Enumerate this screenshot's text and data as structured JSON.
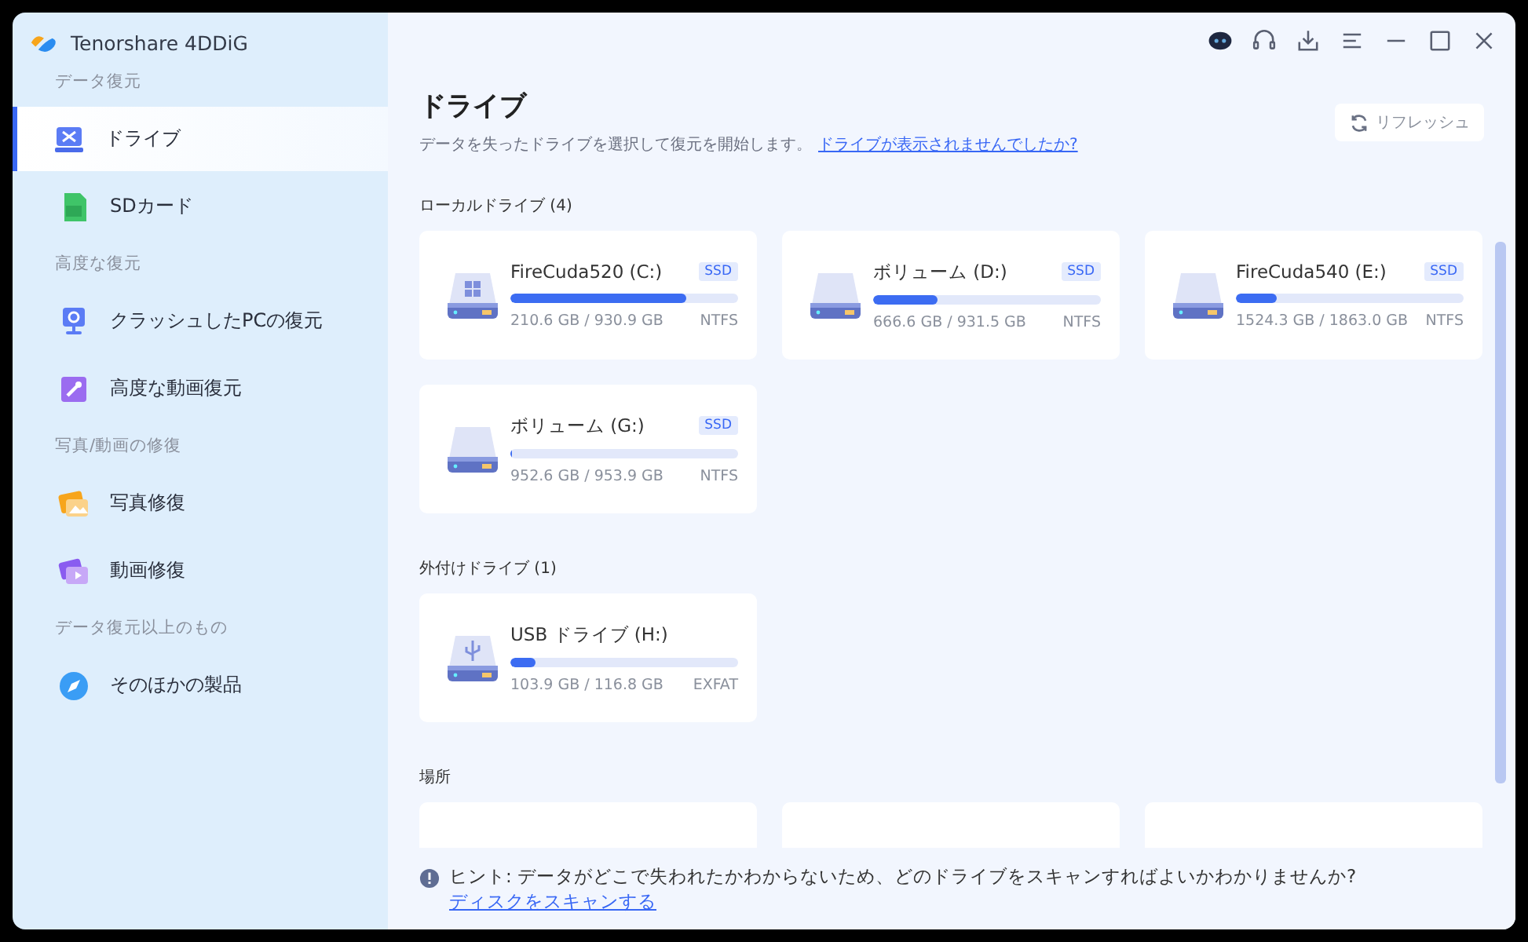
{
  "app": {
    "name": "Tenorshare 4DDiG"
  },
  "sidebar": {
    "groups": [
      {
        "title": "データ復元",
        "items": [
          {
            "label": "ドライブ",
            "kind": "drive",
            "selected": true
          },
          {
            "label": "SDカード",
            "kind": "sd",
            "selected": false
          }
        ]
      },
      {
        "title": "高度な復元",
        "items": [
          {
            "label": "クラッシュしたPCの復元",
            "kind": "pc",
            "selected": false
          },
          {
            "label": "高度な動画復元",
            "kind": "tool",
            "selected": false
          }
        ]
      },
      {
        "title": "写真/動画の修復",
        "items": [
          {
            "label": "写真修復",
            "kind": "photo",
            "selected": false
          },
          {
            "label": "動画修復",
            "kind": "video",
            "selected": false
          }
        ]
      },
      {
        "title": "データ復元以上のもの",
        "items": [
          {
            "label": "そのほかの製品",
            "kind": "compass",
            "selected": false
          }
        ]
      }
    ]
  },
  "page": {
    "title": "ドライブ",
    "subtitle": "データを失ったドライブを選択して復元を開始します。",
    "link": "ドライブが表示されませんでしたか?",
    "refresh": "リフレッシュ"
  },
  "sections": [
    {
      "title": "ローカルドライブ (4)",
      "drives": [
        {
          "name": "FireCuda520 (C:)",
          "kind": "system",
          "badge": "SSD",
          "level": 0.77,
          "size": "210.6 GB / 930.9 GB",
          "fs": "NTFS"
        },
        {
          "name": "ボリューム (D:)",
          "kind": "plain",
          "badge": "SSD",
          "level": 0.28,
          "size": "666.6 GB / 931.5 GB",
          "fs": "NTFS"
        },
        {
          "name": "FireCuda540 (E:)",
          "kind": "plain",
          "badge": "SSD",
          "level": 0.18,
          "size": "1524.3 GB / 1863.0 GB",
          "fs": "NTFS"
        },
        {
          "name": "ボリューム (G:)",
          "kind": "plain",
          "badge": "SSD",
          "level": 0.01,
          "size": "952.6 GB / 953.9 GB",
          "fs": "NTFS"
        }
      ]
    },
    {
      "title": "外付けドライブ (1)",
      "drives": [
        {
          "name": "USB ドライブ (H:)",
          "kind": "usb",
          "level": 0.11,
          "size": "103.9 GB / 116.8 GB",
          "fs": "EXFAT"
        }
      ]
    },
    {
      "title": "場所",
      "drives": [
        {
          "kind": "location"
        },
        {
          "kind": "location"
        },
        {
          "kind": "location"
        }
      ]
    }
  ],
  "hint": {
    "text": "ヒント: データがどこで失われたかわからないため、どのドライブをスキャンすればよいかわかりませんか?",
    "link": "ディスクをスキャンする"
  }
}
